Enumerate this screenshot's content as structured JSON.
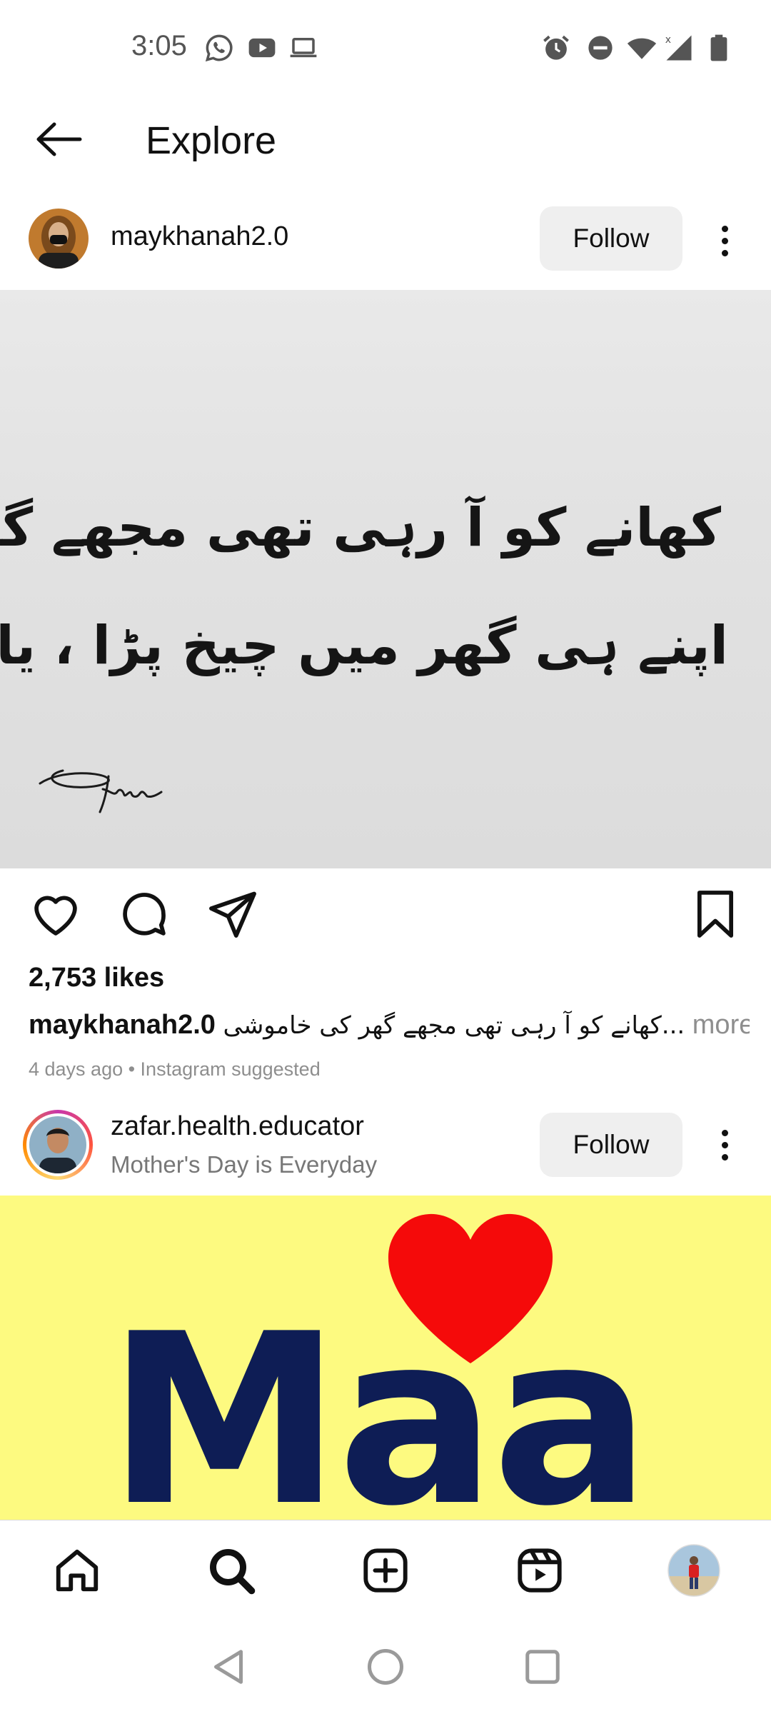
{
  "status_bar": {
    "time": "3:05",
    "left_icons": [
      "whatsapp-icon",
      "youtube-icon",
      "laptop-icon"
    ],
    "right_icons": [
      "alarm-icon",
      "do-not-disturb-icon",
      "wifi-icon",
      "signal-icon",
      "battery-icon"
    ]
  },
  "header": {
    "title": "Explore"
  },
  "post1": {
    "username": "maykhanah2.0",
    "follow_label": "Follow",
    "image_text_line1": "کھانے کو آ رہی تھی مجھے گھر کی خاموشی",
    "image_text_line2": "اپنے ہی گھر میں چیخ پڑا ، یار کوئی ہے ؟",
    "signature": "Tiyar",
    "likes": "2,753 likes",
    "caption_user": "maykhanah2.0",
    "caption_text": "کھانے کو آ رہی تھی مجھے گھر کی خاموشی...",
    "caption_more": "more",
    "meta": "4 days ago • Instagram suggested"
  },
  "post2": {
    "username": "zafar.health.educator",
    "subtitle": "Mother's Day is Everyday",
    "follow_label": "Follow",
    "image_text": "Maa",
    "image_bg": "#fdfa80",
    "heart_color": "#f50a0a",
    "text_color": "#0e1d55"
  },
  "bottom_nav": {
    "items": [
      "home-icon",
      "search-icon",
      "create-icon",
      "reels-icon",
      "profile-avatar"
    ]
  },
  "system_nav": {
    "items": [
      "back-triangle-icon",
      "home-circle-icon",
      "recents-square-icon"
    ]
  }
}
